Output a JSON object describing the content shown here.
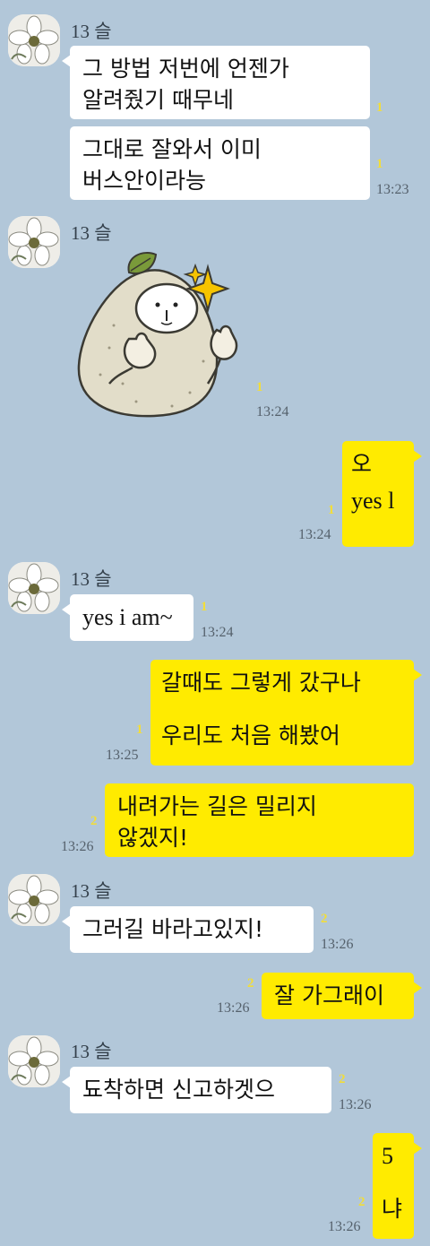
{
  "sender_name": "13 슬",
  "messages": [
    {
      "text_lines": [
        "그 방법 저번에 언젠가",
        "알려줬기 때무네"
      ],
      "unread": "1"
    },
    {
      "text_lines": [
        "그대로 잘와서 이미",
        "버스안이라능"
      ],
      "unread": "1",
      "time": "13:23"
    },
    {
      "sticker": "pear-character-thumbs-up-sticker",
      "unread": "1",
      "time": "13:24"
    },
    {
      "text_lines": [
        "오",
        "yes  l"
      ],
      "unread": "1",
      "time": "13:24"
    },
    {
      "text_lines": [
        "yes i am~"
      ],
      "unread": "1",
      "time": "13:24"
    },
    {
      "text_lines": [
        "갈때도 그렇게 갔구나",
        "우리도 처음 해봤어"
      ],
      "unread": "1",
      "time": "13:25"
    },
    {
      "text_lines": [
        "내려가는 길은 밀리지",
        "않겠지!"
      ],
      "unread": "2",
      "time": "13:26"
    },
    {
      "text_lines": [
        "그러길 바라고있지!"
      ],
      "unread": "2",
      "time": "13:26"
    },
    {
      "text_lines": [
        "잘 가그래이"
      ],
      "unread": "2",
      "time": "13:26"
    },
    {
      "text_lines": [
        "됴착하면 신고하겟으"
      ],
      "unread": "2",
      "time": "13:26"
    },
    {
      "text_lines": [
        "5",
        "냐"
      ],
      "unread": "2",
      "time": "13:26"
    }
  ],
  "colors": {
    "background": "#b2c7d9",
    "my_bubble": "#ffeb00",
    "their_bubble": "#ffffff",
    "unread": "#f2dd3a"
  }
}
